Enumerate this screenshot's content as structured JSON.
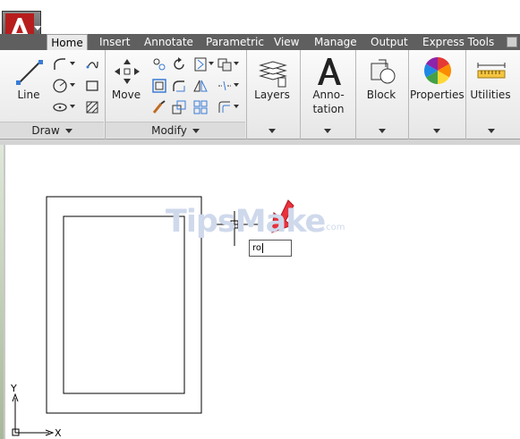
{
  "tabs": [
    "Home",
    "Insert",
    "Annotate",
    "Parametric",
    "View",
    "Manage",
    "Output",
    "Express Tools"
  ],
  "panels": {
    "draw": {
      "title": "Draw",
      "line_label": "Line"
    },
    "modify": {
      "title": "Modify",
      "move_label": "Move"
    },
    "layers": {
      "label": "Layers"
    },
    "annotation": {
      "label_line1": "Anno-",
      "label_line2": "tation"
    },
    "block": {
      "label": "Block"
    },
    "properties": {
      "label": "Properties"
    },
    "utilities": {
      "label": "Utilities"
    }
  },
  "command_input": {
    "value": "ro"
  },
  "watermark": {
    "main": "TipsMake",
    "suffix": ".com"
  },
  "ucs": {
    "x": "X",
    "y": "Y"
  },
  "colors": {
    "tab_bar": "#5f5f5f",
    "arrow": "#e8323c",
    "ribbon": "#ececec"
  }
}
